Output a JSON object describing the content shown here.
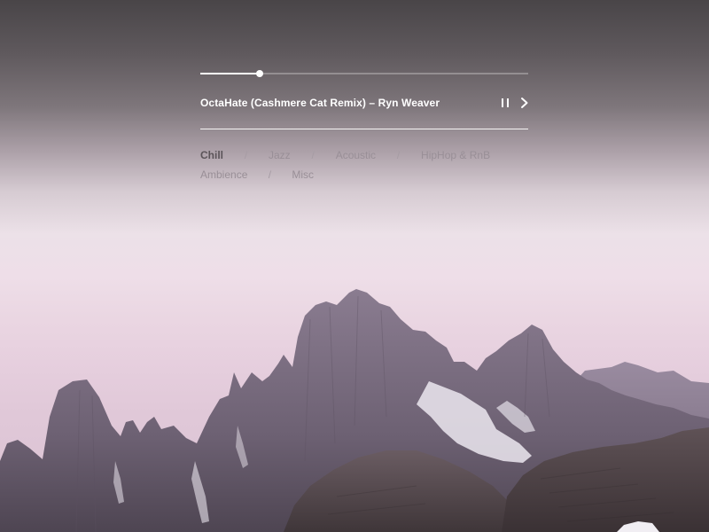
{
  "player": {
    "progress": 0.18,
    "track_title": "OctaHate (Cashmere Cat Remix) – Ryn Weaver",
    "pause_icon": "pause-icon",
    "next_icon": "chevron-right-icon"
  },
  "genres": {
    "separator": "/",
    "active": "Chill",
    "items": [
      "Chill",
      "Jazz",
      "Acoustic",
      "HipHop & RnB",
      "Ambience",
      "Misc"
    ]
  },
  "colors": {
    "text_primary": "#ffffff",
    "genre_active": "#5b5459",
    "genre_inactive": "#998f97"
  }
}
